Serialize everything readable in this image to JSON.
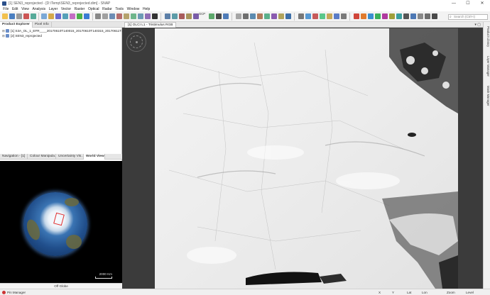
{
  "window": {
    "title": "[1] SEN3_reprojected - [D:\\Temp\\SEN3_reprojected.dim] - SNAP",
    "minimize": "—",
    "maximize": "☐",
    "close": "✕"
  },
  "menu": [
    "File",
    "Edit",
    "View",
    "Analysis",
    "Layer",
    "Vector",
    "Raster",
    "Optical",
    "Radar",
    "Tools",
    "Window",
    "Help"
  ],
  "toolbar": {
    "search_placeholder": "Search (Ctrl+I)",
    "gcp_label": "GCP"
  },
  "left_panel": {
    "top_tabs": [
      "Product Explorer",
      "Pixel Info"
    ],
    "products": [
      {
        "expander": "⊞",
        "label": "[1] S3A_OL_1_EFR____20170610T140015_20170610T140315_20170611T182624_0179"
      },
      {
        "expander": "⊞",
        "label": "[2] SEN3_reprojected"
      }
    ],
    "bottom_tabs": [
      "Navigation - [1]",
      "Colour Manipula...",
      "Uncertainty Vis...",
      "World View"
    ],
    "world_view": {
      "scale_label": "2000 Km",
      "footer": "Off Globe"
    }
  },
  "document": {
    "tab_label": "[1] OLCI L1 - Tristimulus RGB",
    "view_controls": "▾ ▢"
  },
  "right_tabs": [
    "Product Library",
    "Layer Manager",
    "Mask Manager"
  ],
  "statusbar": {
    "left": "Pin Manager",
    "x": "X",
    "y": "Y",
    "lat": "Lat",
    "lon": "Lon",
    "zoom": "Zoom",
    "level": "Level"
  },
  "colors": {
    "ice": "#f2f2f2",
    "open_water": "#1b1b1b",
    "globe_ocean": "#214f8c",
    "dark_panel": "#3b3b3b"
  }
}
